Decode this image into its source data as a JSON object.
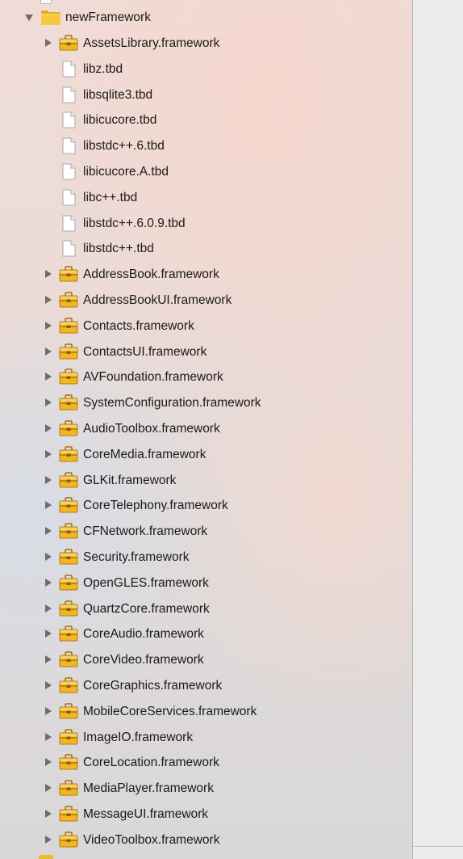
{
  "navigator": {
    "group": {
      "name": "newFramework",
      "icon": "folder-icon",
      "expanded": true
    },
    "items": [
      {
        "label": "AssetsLibrary.framework",
        "kind": "framework",
        "expandable": true
      },
      {
        "label": "libz.tbd",
        "kind": "file",
        "expandable": false
      },
      {
        "label": "libsqlite3.tbd",
        "kind": "file",
        "expandable": false
      },
      {
        "label": "libicucore.tbd",
        "kind": "file",
        "expandable": false
      },
      {
        "label": "libstdc++.6.tbd",
        "kind": "file",
        "expandable": false
      },
      {
        "label": "libicucore.A.tbd",
        "kind": "file",
        "expandable": false
      },
      {
        "label": "libc++.tbd",
        "kind": "file",
        "expandable": false
      },
      {
        "label": "libstdc++.6.0.9.tbd",
        "kind": "file",
        "expandable": false
      },
      {
        "label": "libstdc++.tbd",
        "kind": "file",
        "expandable": false
      },
      {
        "label": "AddressBook.framework",
        "kind": "framework",
        "expandable": true
      },
      {
        "label": "AddressBookUI.framework",
        "kind": "framework",
        "expandable": true
      },
      {
        "label": "Contacts.framework",
        "kind": "framework",
        "expandable": true
      },
      {
        "label": "ContactsUI.framework",
        "kind": "framework",
        "expandable": true
      },
      {
        "label": "AVFoundation.framework",
        "kind": "framework",
        "expandable": true
      },
      {
        "label": "SystemConfiguration.framework",
        "kind": "framework",
        "expandable": true
      },
      {
        "label": "AudioToolbox.framework",
        "kind": "framework",
        "expandable": true
      },
      {
        "label": "CoreMedia.framework",
        "kind": "framework",
        "expandable": true
      },
      {
        "label": "GLKit.framework",
        "kind": "framework",
        "expandable": true
      },
      {
        "label": "CoreTelephony.framework",
        "kind": "framework",
        "expandable": true
      },
      {
        "label": "CFNetwork.framework",
        "kind": "framework",
        "expandable": true
      },
      {
        "label": "Security.framework",
        "kind": "framework",
        "expandable": true
      },
      {
        "label": "OpenGLES.framework",
        "kind": "framework",
        "expandable": true
      },
      {
        "label": "QuartzCore.framework",
        "kind": "framework",
        "expandable": true
      },
      {
        "label": "CoreAudio.framework",
        "kind": "framework",
        "expandable": true
      },
      {
        "label": "CoreVideo.framework",
        "kind": "framework",
        "expandable": true
      },
      {
        "label": "CoreGraphics.framework",
        "kind": "framework",
        "expandable": true
      },
      {
        "label": "MobileCoreServices.framework",
        "kind": "framework",
        "expandable": true
      },
      {
        "label": "ImageIO.framework",
        "kind": "framework",
        "expandable": true
      },
      {
        "label": "CoreLocation.framework",
        "kind": "framework",
        "expandable": true
      },
      {
        "label": "MediaPlayer.framework",
        "kind": "framework",
        "expandable": true
      },
      {
        "label": "MessageUI.framework",
        "kind": "framework",
        "expandable": true
      },
      {
        "label": "VideoToolbox.framework",
        "kind": "framework",
        "expandable": true
      }
    ]
  },
  "icons": {
    "framework": "toolbox-icon",
    "file": "document-icon",
    "disclosure_collapsed": "disclosure-triangle-right-icon",
    "disclosure_expanded": "disclosure-triangle-down-icon"
  },
  "colors": {
    "folder_yellow": "#f6c13a",
    "toolbox_yellow": "#f2b623",
    "text": "#1a1a1a",
    "disclosure": "#6d6d6d",
    "editor_bg": "#ececec"
  }
}
